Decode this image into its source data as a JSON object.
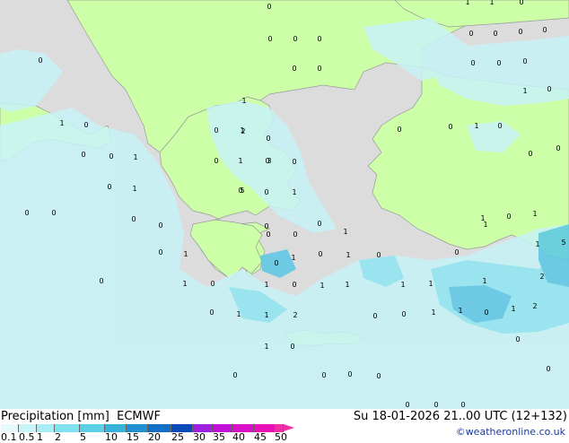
{
  "title": {
    "left": "Precipitation [mm]  ECMWF",
    "right": "Su 18-01-2026 21..00 UTC (12+132)"
  },
  "credit": "©weatheronline.co.uk",
  "legend": {
    "ticks": [
      "0.1",
      "0.5",
      "1",
      "2",
      "5",
      "10",
      "15",
      "20",
      "25",
      "30",
      "35",
      "40",
      "45",
      "50"
    ],
    "colors": [
      "#e6f9fb",
      "#c8f3f8",
      "#a6edf5",
      "#7fe2ee",
      "#5bd0e6",
      "#39b2db",
      "#2090d0",
      "#1070c6",
      "#0a4ab8",
      "#a020e0",
      "#c010d8",
      "#d810c8",
      "#e810b8",
      "#f030a8"
    ]
  },
  "colors": {
    "sea": "#dcdcdc",
    "land": "#ccffa8",
    "border": "#9a9a9a",
    "precip_light": "#c8f3f8",
    "precip_mid": "#8ee6f2",
    "precip_heavy": "#5bc8e6"
  },
  "values": [
    "0",
    "1",
    "2",
    "3",
    "5"
  ],
  "map_labels": [
    {
      "t": "0"
    },
    {
      "t": "1"
    },
    {
      "t": "1"
    },
    {
      "t": "0"
    },
    {
      "t": "0"
    },
    {
      "t": "0"
    },
    {
      "t": "0"
    },
    {
      "t": "0"
    },
    {
      "t": "0"
    },
    {
      "t": "0"
    },
    {
      "t": "0"
    },
    {
      "t": "0"
    },
    {
      "t": "0"
    },
    {
      "t": "0"
    },
    {
      "t": "0"
    },
    {
      "t": "0"
    },
    {
      "t": "0"
    },
    {
      "t": "1"
    },
    {
      "t": "1"
    },
    {
      "t": "0"
    },
    {
      "t": "1"
    },
    {
      "t": "0"
    },
    {
      "t": "0"
    },
    {
      "t": "0"
    },
    {
      "t": "0"
    },
    {
      "t": "1"
    },
    {
      "t": "1"
    },
    {
      "t": "0"
    },
    {
      "t": "0"
    },
    {
      "t": "2"
    },
    {
      "t": "0"
    },
    {
      "t": "1"
    },
    {
      "t": "0"
    },
    {
      "t": "1"
    },
    {
      "t": "0"
    },
    {
      "t": "0"
    },
    {
      "t": "0"
    },
    {
      "t": "0"
    },
    {
      "t": "3"
    },
    {
      "t": "0"
    },
    {
      "t": "0"
    },
    {
      "t": "0"
    },
    {
      "t": "1"
    },
    {
      "t": "0"
    },
    {
      "t": "1"
    },
    {
      "t": "0"
    },
    {
      "t": "5"
    },
    {
      "t": "1"
    },
    {
      "t": "0"
    },
    {
      "t": "1"
    },
    {
      "t": "0"
    },
    {
      "t": "0"
    },
    {
      "t": "0"
    },
    {
      "t": "0"
    },
    {
      "t": "1"
    },
    {
      "t": "0"
    },
    {
      "t": "1"
    },
    {
      "t": "0"
    },
    {
      "t": "0"
    },
    {
      "t": "1"
    },
    {
      "t": "5"
    },
    {
      "t": "0"
    },
    {
      "t": "0"
    },
    {
      "t": "1"
    },
    {
      "t": "1"
    },
    {
      "t": "0"
    },
    {
      "t": "0"
    },
    {
      "t": "0"
    },
    {
      "t": "1"
    },
    {
      "t": "0"
    },
    {
      "t": "1"
    },
    {
      "t": "0"
    },
    {
      "t": "1"
    },
    {
      "t": "0"
    },
    {
      "t": "1"
    },
    {
      "t": "1"
    },
    {
      "t": "1"
    },
    {
      "t": "1"
    },
    {
      "t": "0"
    },
    {
      "t": "1"
    },
    {
      "t": "1"
    },
    {
      "t": "0"
    },
    {
      "t": "0"
    },
    {
      "t": "0"
    },
    {
      "t": "2"
    },
    {
      "t": "1"
    },
    {
      "t": "1"
    },
    {
      "t": "2"
    },
    {
      "t": "1"
    },
    {
      "t": "2"
    },
    {
      "t": "1"
    },
    {
      "t": "0"
    },
    {
      "t": "1"
    },
    {
      "t": "0"
    },
    {
      "t": "0"
    },
    {
      "t": "0"
    },
    {
      "t": "0"
    },
    {
      "t": "0"
    },
    {
      "t": "0"
    },
    {
      "t": "0"
    },
    {
      "t": "0"
    },
    {
      "t": "0"
    }
  ]
}
